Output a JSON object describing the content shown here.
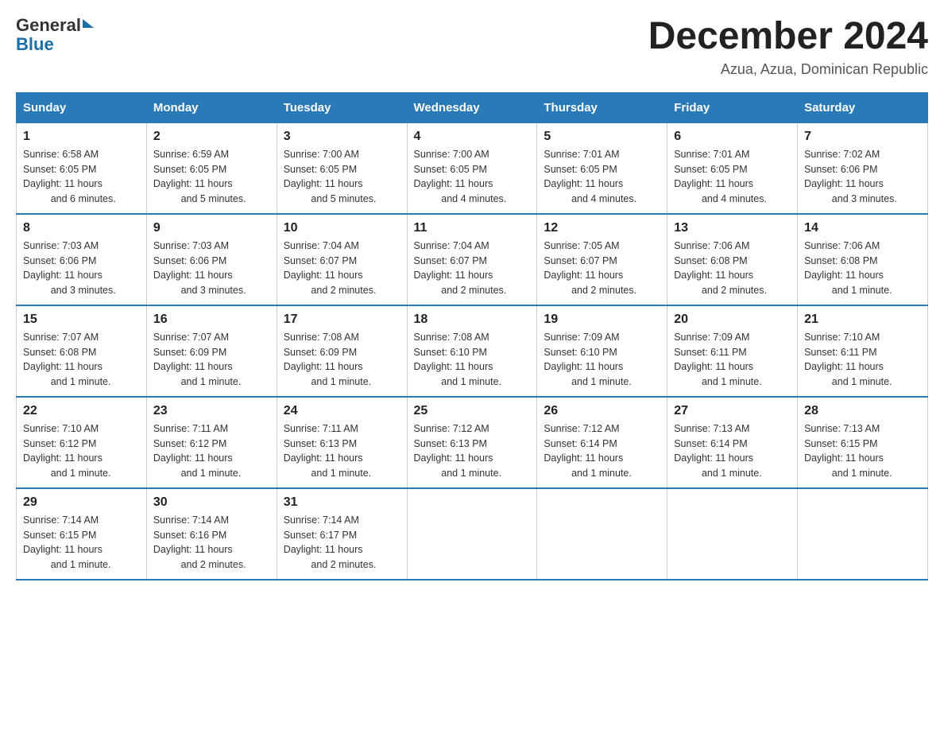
{
  "logo": {
    "text_general": "General",
    "text_blue": "Blue"
  },
  "title": "December 2024",
  "subtitle": "Azua, Azua, Dominican Republic",
  "days_header": [
    "Sunday",
    "Monday",
    "Tuesday",
    "Wednesday",
    "Thursday",
    "Friday",
    "Saturday"
  ],
  "weeks": [
    [
      {
        "day": "1",
        "sunrise": "6:58 AM",
        "sunset": "6:05 PM",
        "daylight": "11 hours and 6 minutes."
      },
      {
        "day": "2",
        "sunrise": "6:59 AM",
        "sunset": "6:05 PM",
        "daylight": "11 hours and 5 minutes."
      },
      {
        "day": "3",
        "sunrise": "7:00 AM",
        "sunset": "6:05 PM",
        "daylight": "11 hours and 5 minutes."
      },
      {
        "day": "4",
        "sunrise": "7:00 AM",
        "sunset": "6:05 PM",
        "daylight": "11 hours and 4 minutes."
      },
      {
        "day": "5",
        "sunrise": "7:01 AM",
        "sunset": "6:05 PM",
        "daylight": "11 hours and 4 minutes."
      },
      {
        "day": "6",
        "sunrise": "7:01 AM",
        "sunset": "6:05 PM",
        "daylight": "11 hours and 4 minutes."
      },
      {
        "day": "7",
        "sunrise": "7:02 AM",
        "sunset": "6:06 PM",
        "daylight": "11 hours and 3 minutes."
      }
    ],
    [
      {
        "day": "8",
        "sunrise": "7:03 AM",
        "sunset": "6:06 PM",
        "daylight": "11 hours and 3 minutes."
      },
      {
        "day": "9",
        "sunrise": "7:03 AM",
        "sunset": "6:06 PM",
        "daylight": "11 hours and 3 minutes."
      },
      {
        "day": "10",
        "sunrise": "7:04 AM",
        "sunset": "6:07 PM",
        "daylight": "11 hours and 2 minutes."
      },
      {
        "day": "11",
        "sunrise": "7:04 AM",
        "sunset": "6:07 PM",
        "daylight": "11 hours and 2 minutes."
      },
      {
        "day": "12",
        "sunrise": "7:05 AM",
        "sunset": "6:07 PM",
        "daylight": "11 hours and 2 minutes."
      },
      {
        "day": "13",
        "sunrise": "7:06 AM",
        "sunset": "6:08 PM",
        "daylight": "11 hours and 2 minutes."
      },
      {
        "day": "14",
        "sunrise": "7:06 AM",
        "sunset": "6:08 PM",
        "daylight": "11 hours and 1 minute."
      }
    ],
    [
      {
        "day": "15",
        "sunrise": "7:07 AM",
        "sunset": "6:08 PM",
        "daylight": "11 hours and 1 minute."
      },
      {
        "day": "16",
        "sunrise": "7:07 AM",
        "sunset": "6:09 PM",
        "daylight": "11 hours and 1 minute."
      },
      {
        "day": "17",
        "sunrise": "7:08 AM",
        "sunset": "6:09 PM",
        "daylight": "11 hours and 1 minute."
      },
      {
        "day": "18",
        "sunrise": "7:08 AM",
        "sunset": "6:10 PM",
        "daylight": "11 hours and 1 minute."
      },
      {
        "day": "19",
        "sunrise": "7:09 AM",
        "sunset": "6:10 PM",
        "daylight": "11 hours and 1 minute."
      },
      {
        "day": "20",
        "sunrise": "7:09 AM",
        "sunset": "6:11 PM",
        "daylight": "11 hours and 1 minute."
      },
      {
        "day": "21",
        "sunrise": "7:10 AM",
        "sunset": "6:11 PM",
        "daylight": "11 hours and 1 minute."
      }
    ],
    [
      {
        "day": "22",
        "sunrise": "7:10 AM",
        "sunset": "6:12 PM",
        "daylight": "11 hours and 1 minute."
      },
      {
        "day": "23",
        "sunrise": "7:11 AM",
        "sunset": "6:12 PM",
        "daylight": "11 hours and 1 minute."
      },
      {
        "day": "24",
        "sunrise": "7:11 AM",
        "sunset": "6:13 PM",
        "daylight": "11 hours and 1 minute."
      },
      {
        "day": "25",
        "sunrise": "7:12 AM",
        "sunset": "6:13 PM",
        "daylight": "11 hours and 1 minute."
      },
      {
        "day": "26",
        "sunrise": "7:12 AM",
        "sunset": "6:14 PM",
        "daylight": "11 hours and 1 minute."
      },
      {
        "day": "27",
        "sunrise": "7:13 AM",
        "sunset": "6:14 PM",
        "daylight": "11 hours and 1 minute."
      },
      {
        "day": "28",
        "sunrise": "7:13 AM",
        "sunset": "6:15 PM",
        "daylight": "11 hours and 1 minute."
      }
    ],
    [
      {
        "day": "29",
        "sunrise": "7:14 AM",
        "sunset": "6:15 PM",
        "daylight": "11 hours and 1 minute."
      },
      {
        "day": "30",
        "sunrise": "7:14 AM",
        "sunset": "6:16 PM",
        "daylight": "11 hours and 2 minutes."
      },
      {
        "day": "31",
        "sunrise": "7:14 AM",
        "sunset": "6:17 PM",
        "daylight": "11 hours and 2 minutes."
      },
      null,
      null,
      null,
      null
    ]
  ],
  "labels": {
    "sunrise": "Sunrise:",
    "sunset": "Sunset:",
    "daylight": "Daylight:"
  }
}
